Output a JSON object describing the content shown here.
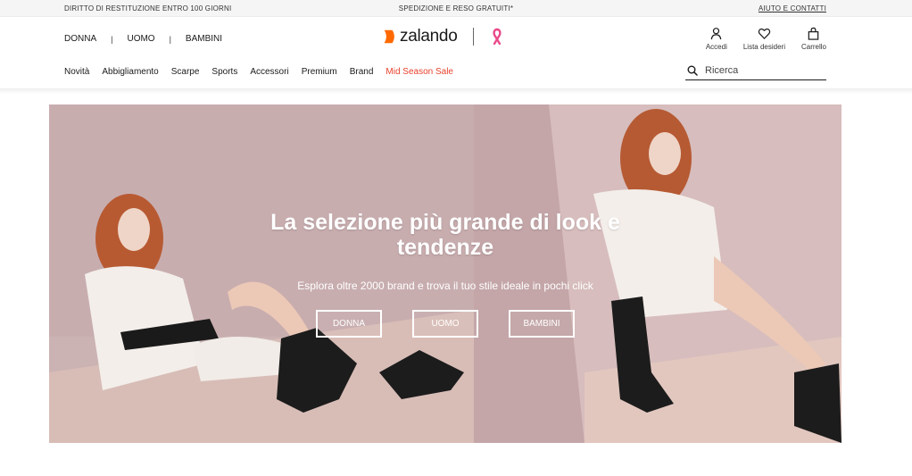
{
  "promo": {
    "left": "DIRITTO DI RESTITUZIONE ENTRO 100 GIORNI",
    "center": "SPEDIZIONE E RESO GRATUITI*",
    "right": "AIUTO E CONTATTI"
  },
  "gender_nav": [
    "DONNA",
    "UOMO",
    "BAMBINI"
  ],
  "gender_separator": "|",
  "logo": {
    "text": "zalando",
    "brand_color": "#ff6900",
    "ribbon_color": "#e94b8b"
  },
  "account": {
    "login": {
      "label": "Accedi",
      "icon": "user-icon"
    },
    "wishlist": {
      "label": "Lista desideri",
      "icon": "heart-icon"
    },
    "cart": {
      "label": "Carrello",
      "icon": "bag-icon"
    }
  },
  "categories": [
    "Novità",
    "Abbigliamento",
    "Scarpe",
    "Sports",
    "Accessori",
    "Premium",
    "Brand"
  ],
  "sale_category": "Mid Season Sale",
  "sale_color": "#e8422c",
  "search": {
    "placeholder": "Ricerca",
    "icon": "search-icon"
  },
  "hero": {
    "title": "La selezione più grande di look e tendenze",
    "subtitle": "Esplora oltre 2000 brand e trova il tuo stile ideale in pochi click",
    "buttons": [
      "DONNA",
      "UOMO",
      "BAMBINI"
    ]
  }
}
